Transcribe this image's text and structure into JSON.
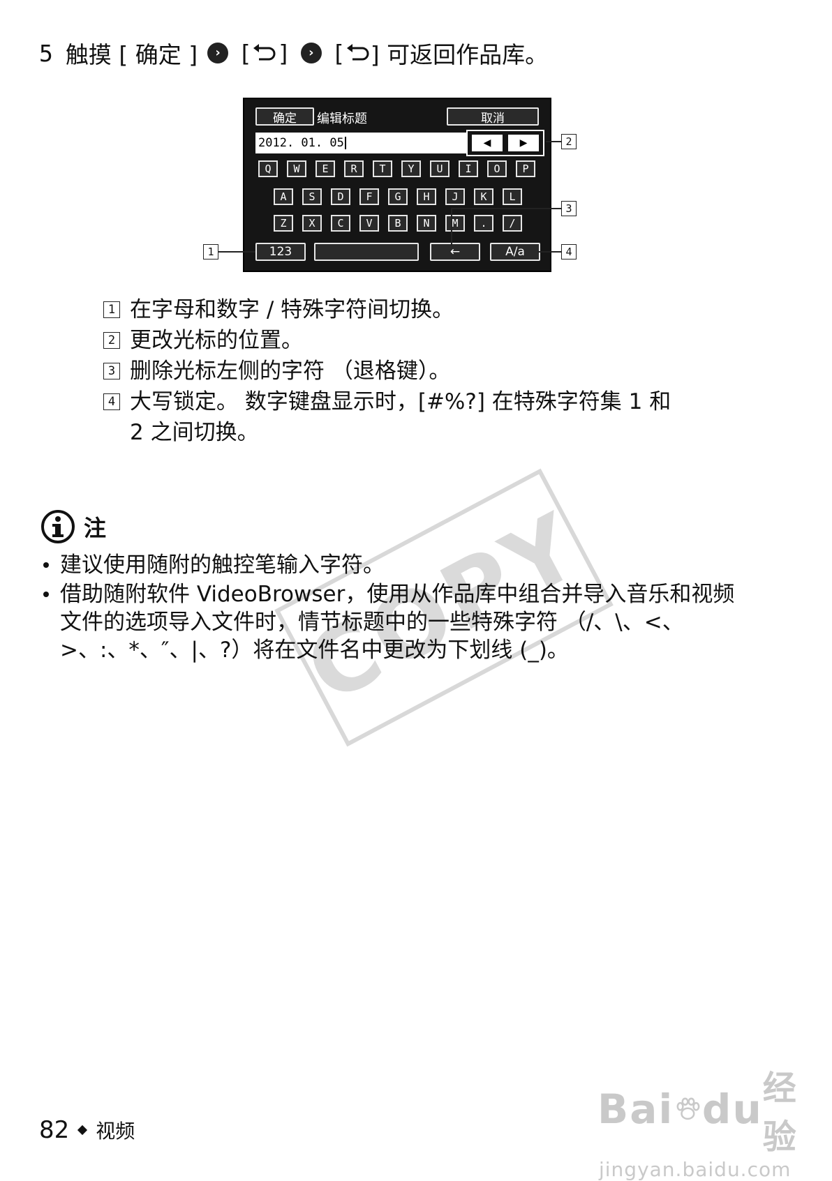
{
  "step": {
    "number": "5",
    "text1": "触摸 [ 确定 ]",
    "text2": "[",
    "text3": "]",
    "text4": "[",
    "text5": "] 可返回作品库。"
  },
  "screen": {
    "confirm_label": "确定",
    "title": "编辑标题",
    "cancel_label": "取消",
    "text_value": "2012. 01. 05",
    "rows": [
      [
        "Q",
        "W",
        "E",
        "R",
        "T",
        "Y",
        "U",
        "I",
        "O",
        "P"
      ],
      [
        "A",
        "S",
        "D",
        "F",
        "G",
        "H",
        "J",
        "K",
        "L"
      ],
      [
        "Z",
        "X",
        "C",
        "V",
        "B",
        "N",
        "M",
        ".",
        "/"
      ]
    ],
    "mode_label": "123",
    "case_label": "A/a"
  },
  "callouts": [
    "1",
    "2",
    "3",
    "4"
  ],
  "legend": [
    {
      "num": "1",
      "text": "在字母和数字 / 特殊字符间切换。"
    },
    {
      "num": "2",
      "text": "更改光标的位置。"
    },
    {
      "num": "3",
      "text": "删除光标左侧的字符 （退格键）。"
    },
    {
      "num": "4",
      "text": "大写锁定。 数字键盘显示时，[#%?] 在特殊字符集 1 和 2 之间切换。"
    }
  ],
  "note": {
    "heading": "注",
    "items": [
      "建议使用随附的触控笔输入字符。",
      "借助随附软件 VideoBrowser，使用从作品库中组合并导入音乐和视频文件的选项导入文件时，情节标题中的一些特殊字符 （/、\\、<、>、:、*、″、|、?）将在文件名中更改为下划线 (_)。"
    ]
  },
  "watermark": "COPY",
  "footer": {
    "page": "82",
    "section": "视频"
  },
  "brand": {
    "logo_a": "Bai",
    "logo_b": "du",
    "logo_c": "经验",
    "site": "jingyan.baidu.com"
  },
  "colors": {
    "screen_bg": "#151515",
    "text": "#111111",
    "watermark": "#d8d8d8"
  }
}
